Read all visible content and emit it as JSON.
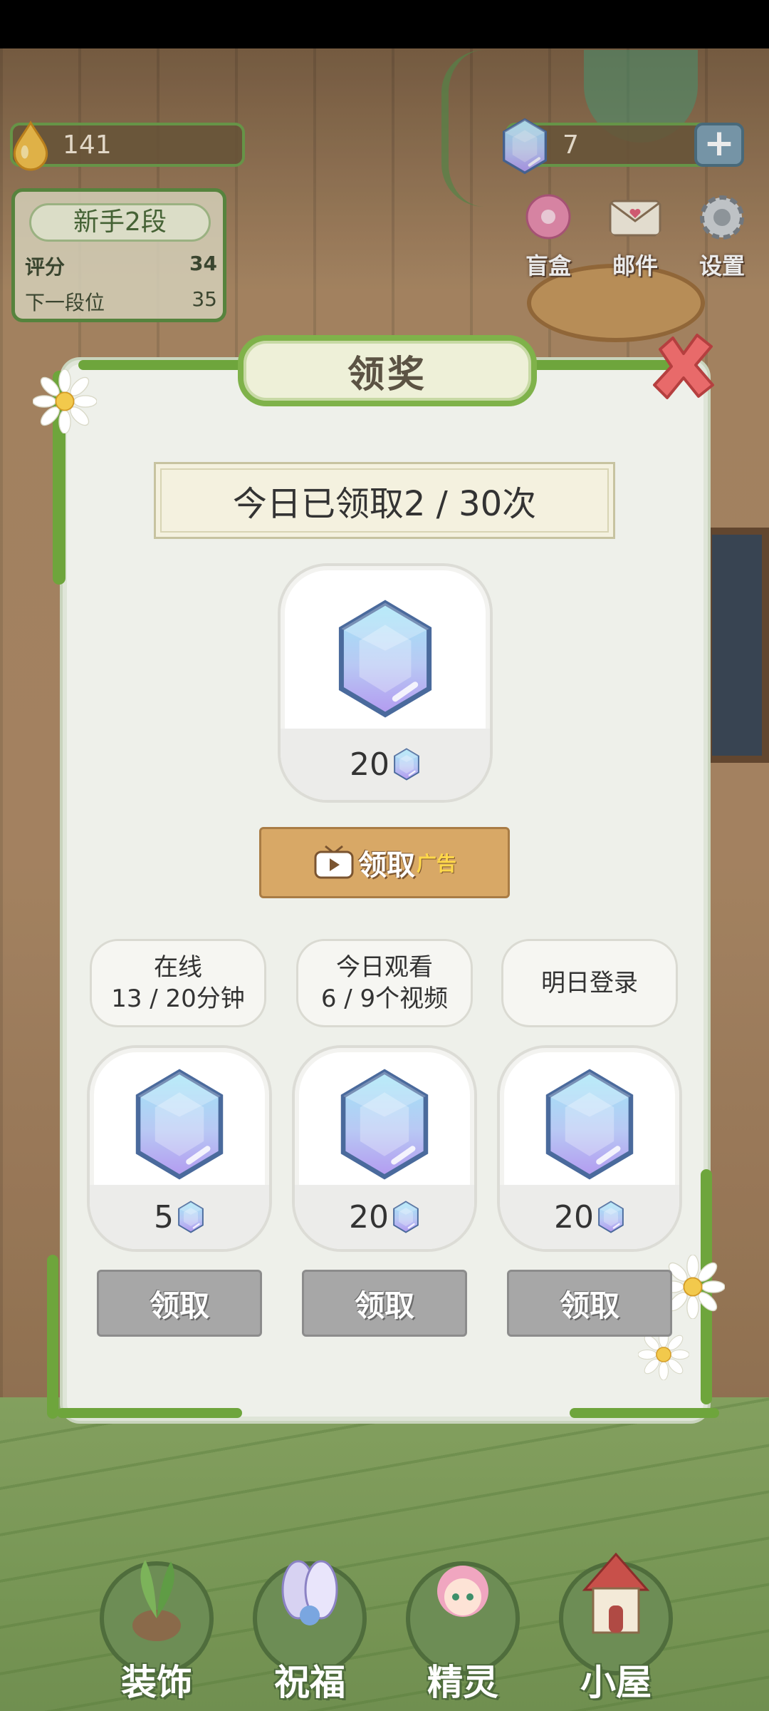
{
  "hud": {
    "drops": "141",
    "gems": "7",
    "plus": "+",
    "rank": {
      "title": "新手2段",
      "score_label": "评分",
      "score_value": "34",
      "next_label": "下一段位",
      "next_value": "35"
    },
    "buttons": {
      "blindbox": "盲盒",
      "mail": "邮件",
      "settings": "设置"
    }
  },
  "dialog": {
    "title": "领奖",
    "daily_count": "今日已领取2 / 30次",
    "main_reward": {
      "amount": "20"
    },
    "ad_claim": {
      "label": "领取",
      "ad_tag": "广告"
    },
    "conditions": [
      {
        "line1": "在线",
        "line2": "13 / 20分钟"
      },
      {
        "line1": "今日观看",
        "line2": "6 / 9个视频"
      },
      {
        "line1": "明日登录",
        "line2": ""
      }
    ],
    "rewards": [
      {
        "amount": "5",
        "button": "领取"
      },
      {
        "amount": "20",
        "button": "领取"
      },
      {
        "amount": "20",
        "button": "领取"
      }
    ]
  },
  "bottom_nav": [
    {
      "label": "装饰"
    },
    {
      "label": "祝福"
    },
    {
      "label": "精灵"
    },
    {
      "label": "小屋"
    }
  ],
  "colors": {
    "gem_gradient_top": "#a8e6f6",
    "gem_gradient_bottom": "#b49cf0",
    "vine_green": "#6ea53c",
    "claim_ad": "#d8a866",
    "claim_disabled": "#a7a7a7"
  }
}
